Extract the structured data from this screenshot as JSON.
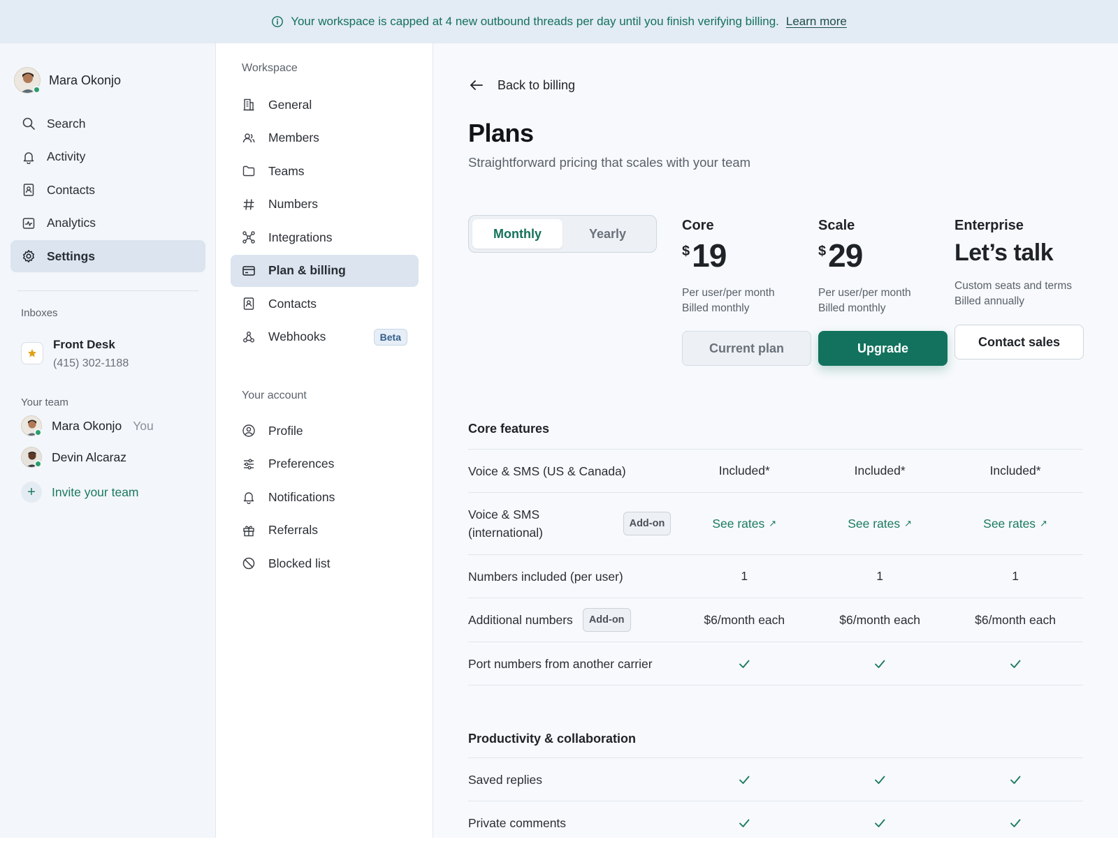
{
  "banner": {
    "message": "Your workspace is capped at 4 new outbound threads per day until you finish verifying billing.",
    "link": "Learn more"
  },
  "sidebar": {
    "user_name": "Mara Okonjo",
    "nav": [
      {
        "label": "Search",
        "icon": "search-icon"
      },
      {
        "label": "Activity",
        "icon": "bell-icon"
      },
      {
        "label": "Contacts",
        "icon": "contact-card-icon"
      },
      {
        "label": "Analytics",
        "icon": "analytics-icon"
      },
      {
        "label": "Settings",
        "icon": "gear-icon",
        "active": true
      }
    ],
    "inboxes_label": "Inboxes",
    "inbox": {
      "name": "Front Desk",
      "phone": "(415) 302-1188",
      "icon": "star-icon"
    },
    "team_label": "Your team",
    "team": [
      {
        "name": "Mara Okonjo",
        "tag": "You"
      },
      {
        "name": "Devin Alcaraz",
        "tag": ""
      }
    ],
    "invite_label": "Invite your team"
  },
  "settings_nav": {
    "workspace_label": "Workspace",
    "workspace_items": [
      {
        "label": "General",
        "icon": "building-icon"
      },
      {
        "label": "Members",
        "icon": "members-icon"
      },
      {
        "label": "Teams",
        "icon": "folder-icon"
      },
      {
        "label": "Numbers",
        "icon": "hash-icon"
      },
      {
        "label": "Integrations",
        "icon": "integrations-icon"
      },
      {
        "label": "Plan & billing",
        "icon": "credit-card-icon",
        "active": true
      },
      {
        "label": "Contacts",
        "icon": "contact-card-icon"
      },
      {
        "label": "Webhooks",
        "icon": "webhook-icon",
        "badge": "Beta"
      }
    ],
    "account_label": "Your account",
    "account_items": [
      {
        "label": "Profile",
        "icon": "profile-icon"
      },
      {
        "label": "Preferences",
        "icon": "sliders-icon"
      },
      {
        "label": "Notifications",
        "icon": "bell-icon"
      },
      {
        "label": "Referrals",
        "icon": "gift-icon"
      },
      {
        "label": "Blocked list",
        "icon": "blocked-icon"
      }
    ]
  },
  "main": {
    "back_label": "Back to billing",
    "title": "Plans",
    "subtitle": "Straightforward pricing that scales with your team",
    "billing_toggle": {
      "monthly": "Monthly",
      "yearly": "Yearly",
      "selected": "Monthly"
    },
    "plans": [
      {
        "name": "Core",
        "currency": "$",
        "price": "19",
        "line1": "Per user/per month",
        "line2": "Billed monthly",
        "button": "Current plan"
      },
      {
        "name": "Scale",
        "currency": "$",
        "price": "29",
        "line1": "Per user/per month",
        "line2": "Billed monthly",
        "button": "Upgrade"
      },
      {
        "name": "Enterprise",
        "headline": "Let’s talk",
        "line1": "Custom seats and terms",
        "line2": "Billed annually",
        "button": "Contact sales"
      }
    ],
    "core_features_title": "Core features",
    "core_features": [
      {
        "label": "Voice & SMS (US & Canada)",
        "values": [
          "Included*",
          "Included*",
          "Included*"
        ]
      },
      {
        "label": "Voice & SMS (international)",
        "badge": "Add-on",
        "values": [
          "See rates",
          "See rates",
          "See rates"
        ],
        "link": true
      },
      {
        "label": "Numbers included (per user)",
        "values": [
          "1",
          "1",
          "1"
        ]
      },
      {
        "label": "Additional numbers",
        "badge": "Add-on",
        "values": [
          "$6/month each",
          "$6/month each",
          "$6/month each"
        ]
      },
      {
        "label": "Port numbers from another carrier",
        "check": true
      }
    ],
    "productivity_title": "Productivity & collaboration",
    "productivity": [
      {
        "label": "Saved replies",
        "check": true
      },
      {
        "label": "Private comments",
        "check": true
      }
    ],
    "accent_color": "#12725d"
  }
}
